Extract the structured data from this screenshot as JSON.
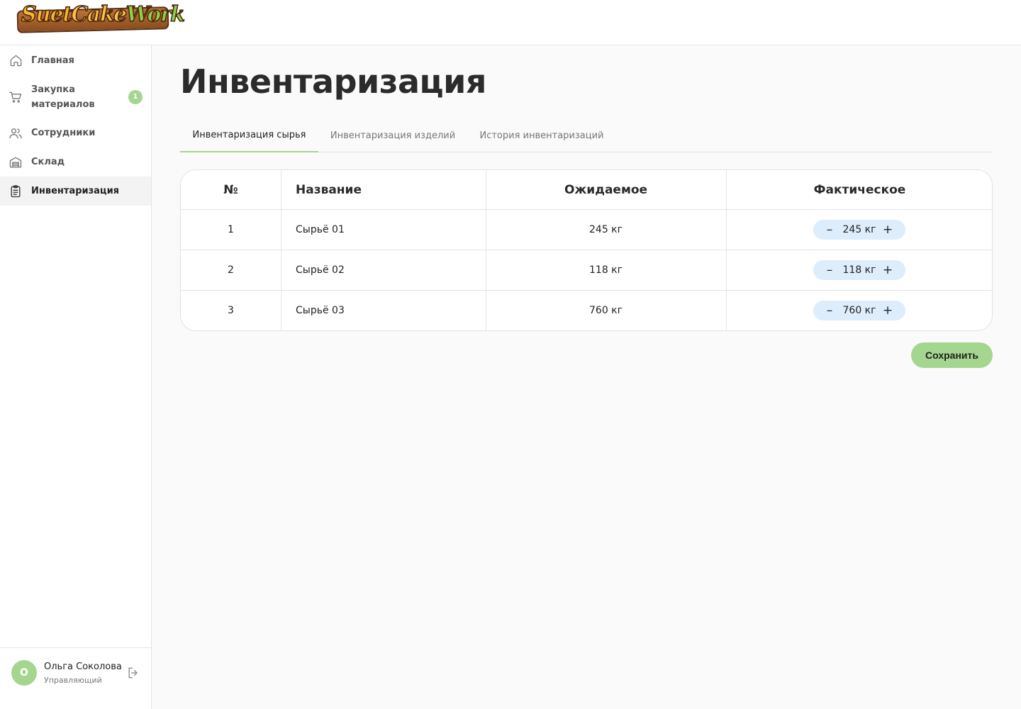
{
  "brand": {
    "logo_word1": "Suet",
    "logo_word2": "Cake",
    "logo_word3": "Work"
  },
  "sidebar": {
    "items": [
      {
        "label": "Главная",
        "icon": "home-icon"
      },
      {
        "label": "Закупка\nматериалов",
        "icon": "cart-icon",
        "badge": "1"
      },
      {
        "label": "Сотрудники",
        "icon": "users-icon"
      },
      {
        "label": "Склад",
        "icon": "warehouse-icon"
      },
      {
        "label": "Инвентаризация",
        "icon": "clipboard-icon",
        "active": true
      }
    ]
  },
  "user": {
    "initial": "О",
    "name": "Ольга Соколова",
    "role": "Управляющий"
  },
  "page": {
    "title": "Инвентаризация"
  },
  "tabs": [
    {
      "label": "Инвентаризация сырья",
      "active": true
    },
    {
      "label": "Инвентаризация изделий",
      "active": false
    },
    {
      "label": "История инвентаризаций",
      "active": false
    }
  ],
  "table": {
    "headers": {
      "num": "№",
      "name": "Название",
      "expected": "Ожидаемое",
      "actual": "Фактическое"
    },
    "rows": [
      {
        "num": "1",
        "name": "Сырьё 01",
        "expected": "245 кг",
        "actual": "245 кг"
      },
      {
        "num": "2",
        "name": "Сырьё 02",
        "expected": "118 кг",
        "actual": "118 кг"
      },
      {
        "num": "3",
        "name": "Сырьё 03",
        "expected": "760 кг",
        "actual": "760 кг"
      }
    ],
    "decrement_symbol": "–",
    "increment_symbol": "+"
  },
  "actions": {
    "save_label": "Сохранить"
  },
  "colors": {
    "accent": "#a5d68f",
    "stepper_bg": "#deedfb",
    "active_nav_bg": "#f3f3f3"
  }
}
